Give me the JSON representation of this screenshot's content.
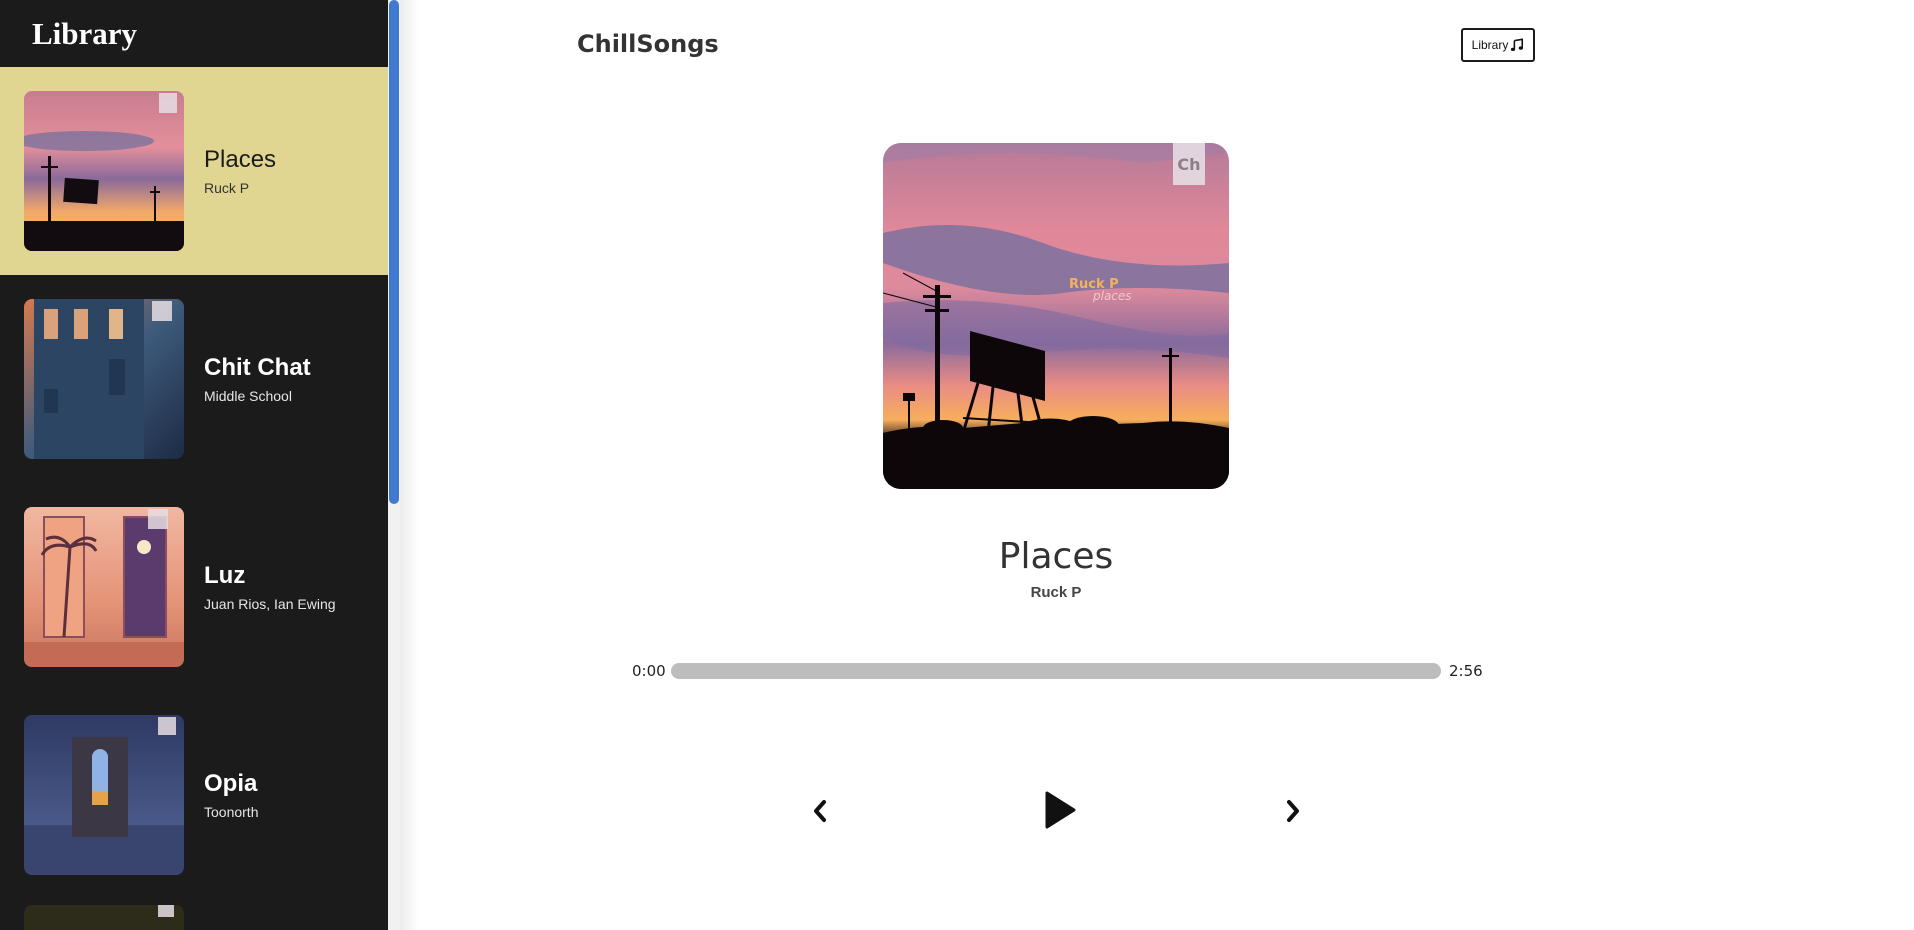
{
  "sidebar": {
    "title": "Library",
    "items": [
      {
        "name": "Places",
        "artist": "Ruck P",
        "active": true
      },
      {
        "name": "Chit Chat",
        "artist": "Middle School",
        "active": false
      },
      {
        "name": "Luz",
        "artist": "Juan Rios, Ian Ewing",
        "active": false
      },
      {
        "name": "Opia",
        "artist": "Toonorth",
        "active": false
      }
    ]
  },
  "header": {
    "app_title": "ChillSongs",
    "library_button_label": "Library",
    "library_button_icon": "music-note-icon"
  },
  "now_playing": {
    "title": "Places",
    "artist": "Ruck P",
    "cover_text_artist": "Ruck P",
    "cover_text_title": "places",
    "current_time": "0:00",
    "duration": "2:56",
    "progress_fraction": 0
  },
  "controls": {
    "prev_icon": "chevron-left-icon",
    "play_icon": "play-icon",
    "next_icon": "chevron-right-icon"
  },
  "colors": {
    "sidebar_bg": "#1b1b1b",
    "active_item_bg": "#e0d591",
    "scrollbar_thumb": "#3f7ad0",
    "progress_track": "#bdbdbd"
  }
}
